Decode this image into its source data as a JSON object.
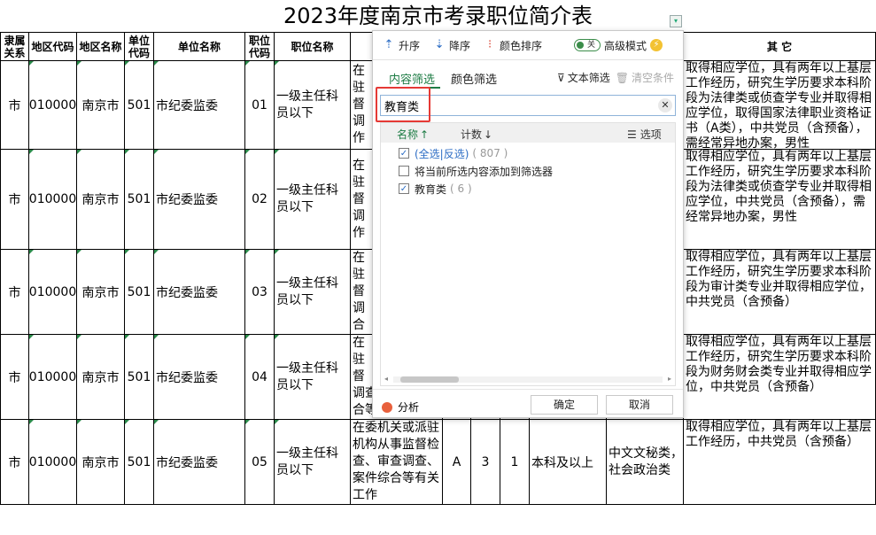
{
  "sheet": {
    "title": "2023年度南京市考录职位简介表",
    "headers": [
      "隶属关系",
      "地区代码",
      "地区名称",
      "单位代码",
      "单位名称",
      "职位代码",
      "职位名称",
      "其  它"
    ],
    "rows": [
      {
        "rel": "市",
        "area_code": "010000",
        "area_name": "南京市",
        "unit_code": "501",
        "unit_name": "市纪委监委",
        "pos_code": "01",
        "pos_name": "一级主任科员以下",
        "desc": "在\n驻\n督\n调\n作",
        "other": "取得相应学位，具有两年以上基层工作经历，研究生学历要求本科阶段为法律类或侦查学专业并取得相应学位，取得国家法律职业资格证书（A类），中共党员（含预备），需经常异地办案，男性"
      },
      {
        "rel": "市",
        "area_code": "010000",
        "area_name": "南京市",
        "unit_code": "501",
        "unit_name": "市纪委监委",
        "pos_code": "02",
        "pos_name": "一级主任科员以下",
        "desc": "在\n驻\n督\n调\n作",
        "other": "取得相应学位，具有两年以上基层工作经历，研究生学历要求本科阶段为法律类或侦查学专业并取得相应学位，中共党员（含预备），需经常异地办案，男性"
      },
      {
        "rel": "市",
        "area_code": "010000",
        "area_name": "南京市",
        "unit_code": "501",
        "unit_name": "市纪委监委",
        "pos_code": "03",
        "pos_name": "一级主任科员以下",
        "desc": "在\n驻\n督\n调\n合",
        "other": "取得相应学位，具有两年以上基层工作经历，研究生学历要求本科阶段为审计类专业并取得相应学位，中共党员（含预备）"
      },
      {
        "rel": "市",
        "area_code": "010000",
        "area_name": "南京市",
        "unit_code": "501",
        "unit_name": "市纪委监委",
        "pos_code": "04",
        "pos_name": "一级主任科员以下",
        "desc": "在\n驻\n督\n调查、案件综\n合等有关工作",
        "other": "取得相应学位，具有两年以上基层工作经历，研究生学历要求本科阶段为财务财会类专业并取得相应学位，中共党员（含预备）"
      },
      {
        "rel": "市",
        "area_code": "010000",
        "area_name": "南京市",
        "unit_code": "501",
        "unit_name": "市纪委监委",
        "pos_code": "05",
        "pos_name": "一级主任科员以下",
        "desc": "在委机关或派驻机构从事监督检查、审查调查、案件综合等有关工作",
        "cat": "A",
        "num": "3",
        "n2": "1",
        "edu": "本科及以上",
        "major": "中文文秘类，社会政治类",
        "other": "取得相应学位，具有两年以上基层工作经历，中共党员（含预备）"
      }
    ]
  },
  "popup": {
    "sort_asc": "升序",
    "sort_desc": "降序",
    "color_sort": "颜色排序",
    "toggle_label": "关",
    "advanced_mode": "高级模式",
    "tab_content": "内容筛选",
    "tab_color": "颜色筛选",
    "text_filter": "文本筛选",
    "clear_conditions": "清空条件",
    "search_value": "教育类",
    "col_name": "名称",
    "col_count": "计数",
    "options": "选项",
    "items": [
      {
        "label": "(全选|反选)",
        "count": "( 807 )",
        "checked": true
      },
      {
        "label": "将当前所选内容添加到筛选器",
        "count": "",
        "checked": false
      },
      {
        "label": "教育类",
        "count": "( 6 )",
        "checked": true
      }
    ],
    "analyze": "分析",
    "ok": "确定",
    "cancel": "取消"
  },
  "colors": {
    "accent": "#1e7c45",
    "link": "#2b6cc4",
    "highlight": "#e53935"
  }
}
